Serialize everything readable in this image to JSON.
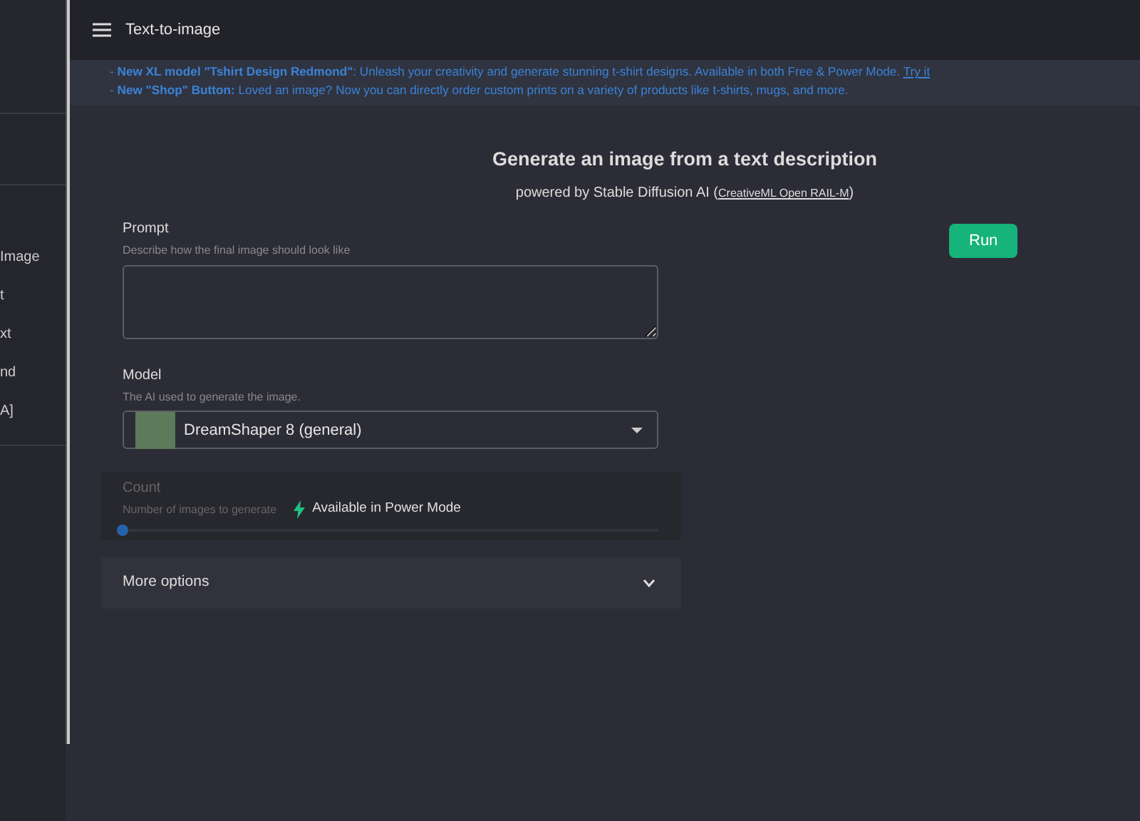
{
  "sidebar": {
    "items": [
      {
        "label": "Image"
      },
      {
        "label": "t"
      },
      {
        "label": "xt"
      },
      {
        "label": "nd"
      },
      {
        "label": "A]"
      }
    ]
  },
  "header": {
    "title": "Text-to-image"
  },
  "announcements": [
    {
      "text": "- **New XL model \"Tshirt Design Redmond\"**: Unleash your creativity and generate stunning t-shirt designs. Available in both Free & Power Mode.",
      "link": "Try it"
    },
    {
      "text": "- **New \"Shop\" Button:** Loved an image? Now you can directly order custom prints on a variety of products like t-shirts, mugs, and more."
    }
  ],
  "heading": {
    "title": "Generate an image from a text description",
    "subtitle": "powered by Stable Diffusion AI (",
    "license_link": "CreativeML Open RAIL-M",
    "subtitle_end": ")"
  },
  "run_button": "Run",
  "fields": [
    {
      "kind": "textarea",
      "label": "Prompt",
      "hint": "Describe how the final image should look like"
    },
    {
      "kind": "select",
      "label": "Model",
      "hint": "The AI used to generate the image.",
      "value": "DreamShaper 8 (general)"
    },
    {
      "kind": "slider",
      "label": "Count",
      "hint": "Number of images to generate",
      "disabled": true,
      "notice": "Available in Power Mode",
      "level": 0
    }
  ],
  "more_options": {
    "label": "More options",
    "expanded": false
  }
}
